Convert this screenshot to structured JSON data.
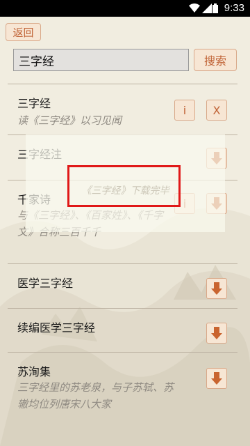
{
  "status_bar": {
    "time": "9:33"
  },
  "header": {
    "back_label": "返回"
  },
  "search": {
    "value": "三字经",
    "button_label": "搜索"
  },
  "list": {
    "items": [
      {
        "title": "三字经",
        "desc": "读《三字经》以习见闻",
        "info_label": "i",
        "delete_label": "X"
      },
      {
        "title": "三字经注",
        "desc": ""
      },
      {
        "title": "千家诗",
        "desc": "与《三字经》、《百家姓》、《千字文》合称三百千千",
        "info_label": "i"
      },
      {
        "title": "医学三字经",
        "desc": ""
      },
      {
        "title": "续编医学三字经",
        "desc": ""
      },
      {
        "title": "苏洵集",
        "desc": "三字经里的苏老泉，与子苏轼、苏辙均位列唐宋八大家"
      }
    ]
  },
  "toast": {
    "message": "《三字经》下载完毕"
  },
  "colors": {
    "accent": "#c06235",
    "button_bg": "#f7e6d4",
    "button_border": "#d9a98a",
    "highlight": "#e01818"
  }
}
